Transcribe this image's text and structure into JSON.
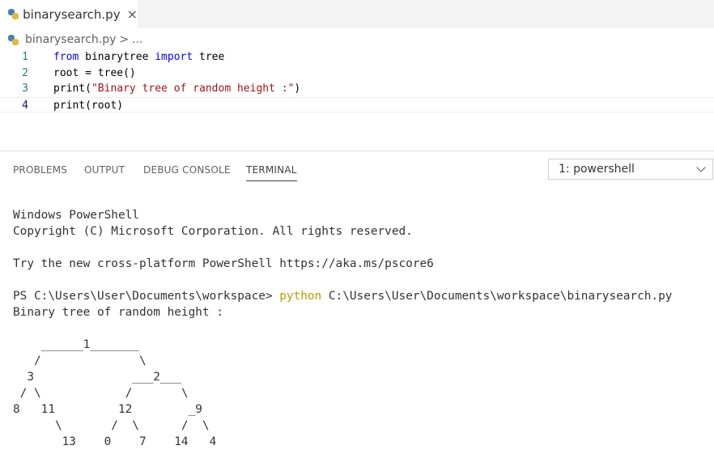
{
  "tab": {
    "filename": "binarysearch.py",
    "close": "×"
  },
  "breadcrumb": {
    "file": "binarysearch.py",
    "sep": ">",
    "more": "..."
  },
  "editor": {
    "lines": [
      {
        "num": "1",
        "parts": [
          {
            "t": "from",
            "k": "kw"
          },
          {
            "t": " binarytree ",
            "k": ""
          },
          {
            "t": "import",
            "k": "kw"
          },
          {
            "t": " tree",
            "k": ""
          }
        ]
      },
      {
        "num": "2",
        "parts": [
          {
            "t": "root = tree()",
            "k": ""
          }
        ]
      },
      {
        "num": "3",
        "parts": [
          {
            "t": "print(",
            "k": ""
          },
          {
            "t": "\"Binary tree of random height :\"",
            "k": "str"
          },
          {
            "t": ")",
            "k": ""
          }
        ]
      },
      {
        "num": "4",
        "parts": [
          {
            "t": "print(root)",
            "k": ""
          }
        ]
      }
    ]
  },
  "panel": {
    "tabs": [
      "PROBLEMS",
      "OUTPUT",
      "DEBUG CONSOLE",
      "TERMINAL"
    ],
    "active_tab": "TERMINAL",
    "terminal_select": "1: powershell"
  },
  "terminal": {
    "line1": "Windows PowerShell",
    "line2": "Copyright (C) Microsoft Corporation. All rights reserved.",
    "line3": "Try the new cross-platform PowerShell https://aka.ms/pscore6",
    "prompt": "PS C:\\Users\\User\\Documents\\workspace> ",
    "command": "python",
    "command_arg": " C:\\Users\\User\\Documents\\workspace\\binarysearch.py",
    "output_heading": "Binary tree of random height :",
    "tree": "    ______1_______\n   /              \\\n  3              ___2___\n / \\            /       \\\n8   11         12        _9\n      \\       /  \\      /  \\\n       13    0    7    14   4"
  }
}
